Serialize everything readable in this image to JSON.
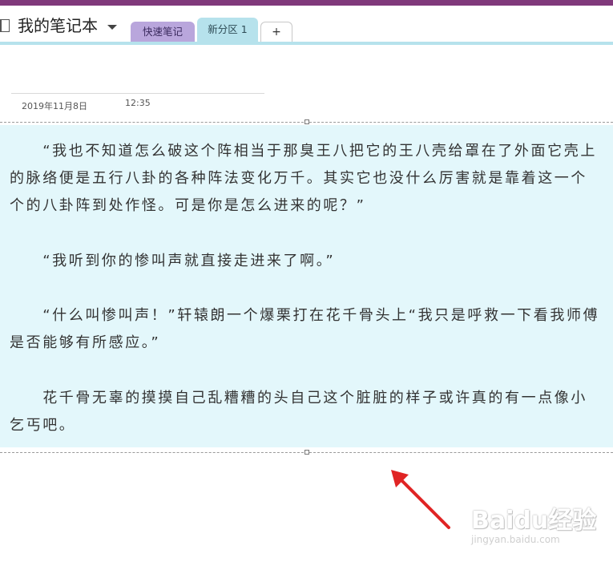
{
  "header": {
    "notebook_title": "我的笔记本",
    "tabs": [
      {
        "label": "快速笔记"
      },
      {
        "label": "新分区 1"
      },
      {
        "label": "+"
      }
    ]
  },
  "page": {
    "date": "2019年11月8日",
    "time": "12:35"
  },
  "note": {
    "paragraphs": [
      "　　“我也不知道怎么破这个阵相当于那臭王八把它的王八壳给罩在了外面它壳上的脉络便是五行八卦的各种阵法变化万千。其实它也没什么厉害就是靠着这一个个的八卦阵到处作怪。可是你是怎么进来的呢？”",
      "　　“我听到你的惨叫声就直接走进来了啊。”",
      "　　“什么叫惨叫声！”轩辕朗一个爆栗打在花千骨头上“我只是呼救一下看我师傅是否能够有所感应。”",
      "　　花千骨无辜的摸摸自己乱糟糟的头自己这个脏脏的样子或许真的有一点像小乞丐吧。"
    ]
  },
  "watermark": {
    "brand": "Baidu经验",
    "domain": "jingyan.baidu.com"
  },
  "colors": {
    "accent": "#80397b",
    "section_tab": "#b6e2ec",
    "quick_tab": "#b9a6dc",
    "note_bg": "#e3f7fb",
    "arrow": "#e02424"
  }
}
